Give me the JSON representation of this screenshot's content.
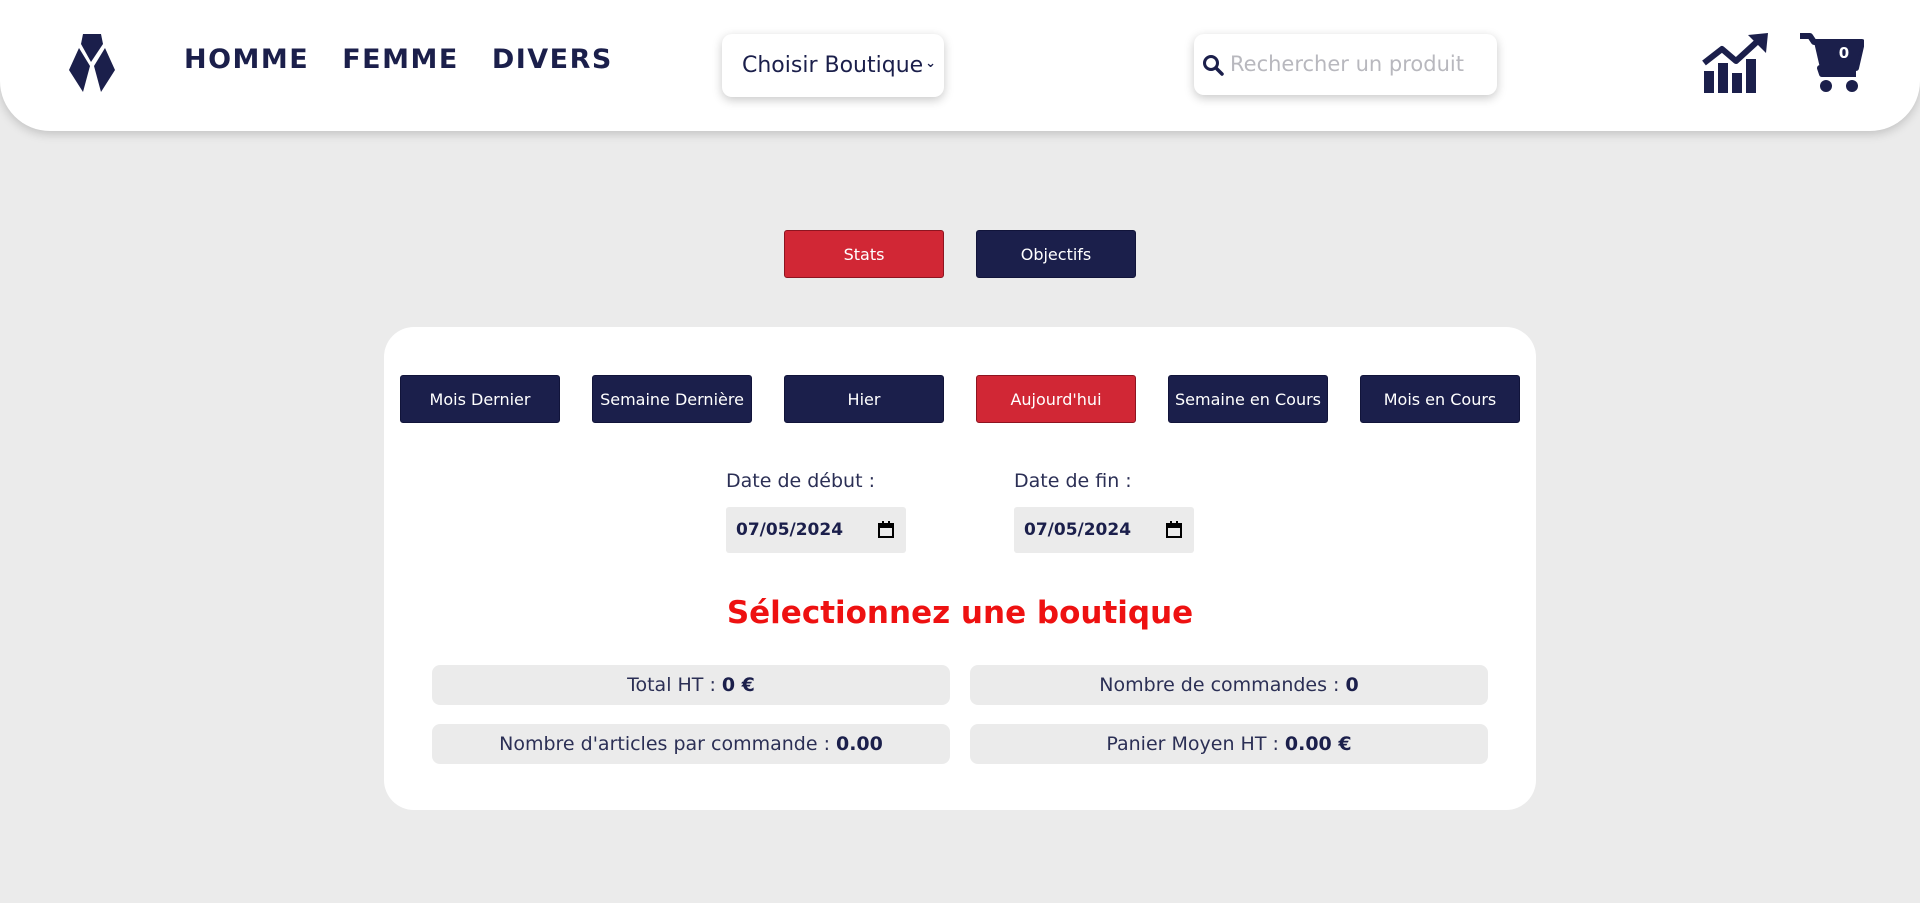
{
  "header": {
    "nav": [
      "HOMME",
      "FEMME",
      "DIVERS"
    ],
    "shop_select": {
      "selected": "Choisir Boutique"
    },
    "search": {
      "placeholder": "Rechercher un produit"
    },
    "cart_count": "0",
    "icons": [
      "logo-icon",
      "search-icon",
      "stats-chart-icon",
      "cart-icon"
    ]
  },
  "view_tabs": [
    "Stats",
    "Objectifs"
  ],
  "periods": [
    "Mois Dernier",
    "Semaine Dernière",
    "Hier",
    "Aujourd'hui",
    "Semaine en Cours",
    "Mois en Cours"
  ],
  "dates": {
    "start_label": "Date de début :",
    "start_value": "07/05/2024",
    "end_label": "Date de fin :",
    "end_value": "07/05/2024"
  },
  "warning": "Sélectionnez une boutique",
  "kpis": [
    {
      "label": "Total HT :",
      "value": "0 €"
    },
    {
      "label": "Nombre de commandes :",
      "value": "0"
    },
    {
      "label": "Nombre d'articles par commande :",
      "value": "0.00"
    },
    {
      "label": "Panier Moyen HT :",
      "value": "0.00 €"
    }
  ],
  "colors": {
    "navy": "#1b1f4b",
    "red": "#d12735",
    "warning": "#ee1111",
    "background": "#ebebeb"
  }
}
